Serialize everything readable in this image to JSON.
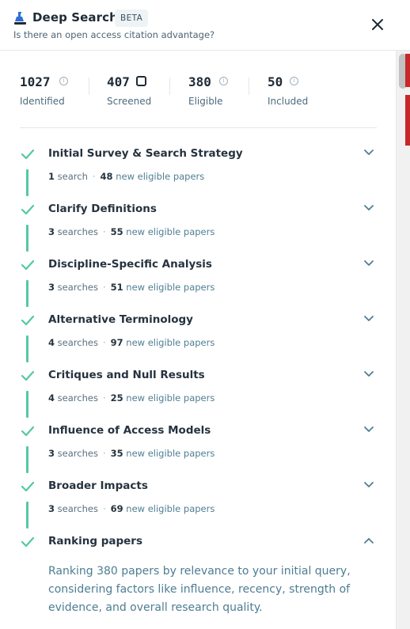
{
  "header": {
    "title": "Deep Search",
    "badge": "BETA",
    "subtitle": "Is there an open access citation advantage?"
  },
  "stats": [
    {
      "value": "1027",
      "label": "Identified"
    },
    {
      "value": "407",
      "label": "Screened"
    },
    {
      "value": "380",
      "label": "Eligible"
    },
    {
      "value": "50",
      "label": "Included"
    }
  ],
  "steps": [
    {
      "title": "Initial Survey & Search Strategy",
      "count": "1",
      "unit": "search",
      "papers": "48",
      "papers_label": "new eligible papers"
    },
    {
      "title": "Clarify Definitions",
      "count": "3",
      "unit": "searches",
      "papers": "55",
      "papers_label": "new eligible papers"
    },
    {
      "title": "Discipline-Specific Analysis",
      "count": "3",
      "unit": "searches",
      "papers": "51",
      "papers_label": "new eligible papers"
    },
    {
      "title": "Alternative Terminology",
      "count": "4",
      "unit": "searches",
      "papers": "97",
      "papers_label": "new eligible papers"
    },
    {
      "title": "Critiques and Null Results",
      "count": "4",
      "unit": "searches",
      "papers": "25",
      "papers_label": "new eligible papers"
    },
    {
      "title": "Influence of Access Models",
      "count": "3",
      "unit": "searches",
      "papers": "35",
      "papers_label": "new eligible papers"
    },
    {
      "title": "Broader Impacts",
      "count": "3",
      "unit": "searches",
      "papers": "69",
      "papers_label": "new eligible papers"
    }
  ],
  "ranking": {
    "title": "Ranking papers",
    "description": "Ranking 380 papers by relevance to your initial query, considering factors like influence, recency, strength of evidence, and overall research quality."
  },
  "colors": {
    "accent_check": "#55c7a6",
    "link_text": "#4f7e93",
    "scroll_marker": "#c62828"
  }
}
